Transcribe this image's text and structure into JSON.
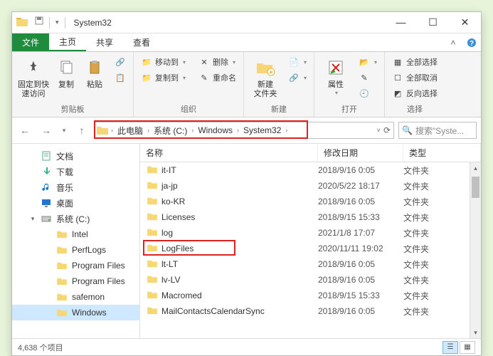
{
  "title": "System32",
  "window_controls": {
    "min": "—",
    "max": "☐",
    "close": "✕"
  },
  "tabs": {
    "file": "文件",
    "home": "主页",
    "share": "共享",
    "view": "查看"
  },
  "ribbon": {
    "clipboard": {
      "label": "剪贴板",
      "pin": "固定到快\n速访问",
      "copy": "复制",
      "paste": "粘贴"
    },
    "organize": {
      "label": "组织",
      "move_to": "移动到",
      "copy_to": "复制到",
      "delete": "删除",
      "rename": "重命名"
    },
    "new": {
      "label": "新建",
      "new_folder": "新建\n文件夹"
    },
    "open": {
      "label": "打开",
      "properties": "属性"
    },
    "select": {
      "label": "选择",
      "select_all": "全部选择",
      "select_none": "全部取消",
      "invert": "反向选择"
    }
  },
  "breadcrumbs": [
    "此电脑",
    "系统 (C:)",
    "Windows",
    "System32"
  ],
  "search_placeholder": "搜索\"Syste...",
  "nav_items": [
    {
      "icon": "doc",
      "label": "文档"
    },
    {
      "icon": "download",
      "label": "下载"
    },
    {
      "icon": "music",
      "label": "音乐"
    },
    {
      "icon": "desktop",
      "label": "桌面"
    },
    {
      "icon": "drive",
      "label": "系统 (C:)",
      "expandable": true
    },
    {
      "icon": "folder",
      "label": "Intel",
      "sub": true
    },
    {
      "icon": "folder",
      "label": "PerfLogs",
      "sub": true
    },
    {
      "icon": "folder",
      "label": "Program Files",
      "sub": true
    },
    {
      "icon": "folder",
      "label": "Program Files",
      "sub": true
    },
    {
      "icon": "folder",
      "label": "safemon",
      "sub": true
    },
    {
      "icon": "folder",
      "label": "Windows",
      "sub": true,
      "selected": true
    }
  ],
  "columns": {
    "name": "名称",
    "date": "修改日期",
    "type": "类型"
  },
  "rows": [
    {
      "name": "it-IT",
      "date": "2018/9/16 0:05",
      "type": "文件夹"
    },
    {
      "name": "ja-jp",
      "date": "2020/5/22 18:17",
      "type": "文件夹"
    },
    {
      "name": "ko-KR",
      "date": "2018/9/16 0:05",
      "type": "文件夹"
    },
    {
      "name": "Licenses",
      "date": "2018/9/15 15:33",
      "type": "文件夹"
    },
    {
      "name": "log",
      "date": "2021/1/8 17:07",
      "type": "文件夹"
    },
    {
      "name": "LogFiles",
      "date": "2020/11/11 19:02",
      "type": "文件夹",
      "highlight": true
    },
    {
      "name": "lt-LT",
      "date": "2018/9/16 0:05",
      "type": "文件夹"
    },
    {
      "name": "lv-LV",
      "date": "2018/9/16 0:05",
      "type": "文件夹"
    },
    {
      "name": "Macromed",
      "date": "2018/9/15 15:33",
      "type": "文件夹"
    },
    {
      "name": "MailContactsCalendarSync",
      "date": "2018/9/16 0:05",
      "type": "文件夹"
    }
  ],
  "status": "4,638 个项目"
}
